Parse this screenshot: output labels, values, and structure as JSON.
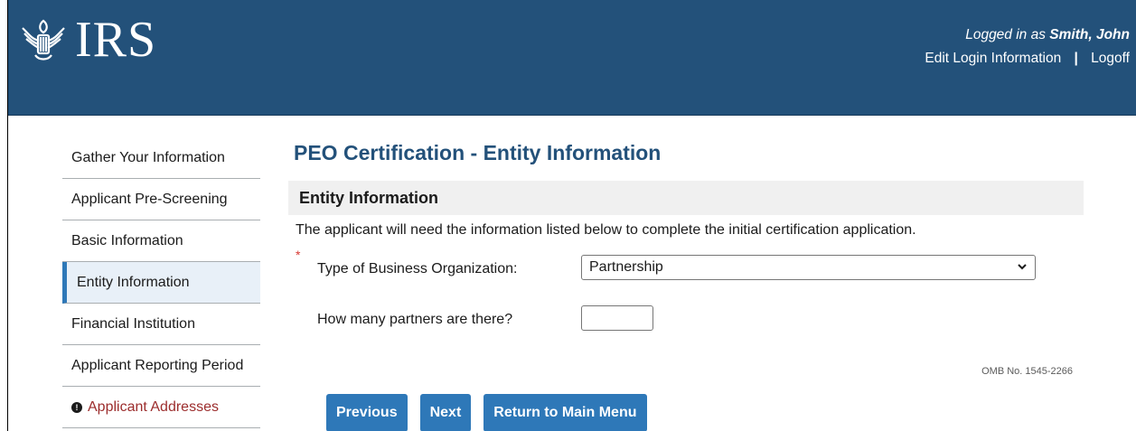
{
  "header": {
    "logo_text": "IRS",
    "logged_in_prefix": "Logged in as",
    "user_name": "Smith, John",
    "edit_login": "Edit Login Information",
    "separator": "|",
    "logoff": "Logoff"
  },
  "sidebar": {
    "items": [
      {
        "label": "Gather Your Information"
      },
      {
        "label": "Applicant Pre-Screening"
      },
      {
        "label": "Basic Information"
      },
      {
        "label": "Entity Information"
      },
      {
        "label": "Financial Institution"
      },
      {
        "label": "Applicant Reporting Period"
      },
      {
        "label": "Applicant Addresses"
      }
    ]
  },
  "main": {
    "page_title": "PEO Certification - Entity Information",
    "section_title": "Entity Information",
    "description": "The applicant will need the information listed below to complete the initial certification application.",
    "required_marker": "*",
    "business_type_label": "Type of Business Organization:",
    "business_type_value": "Partnership",
    "partners_label": "How many partners are there?",
    "partners_value": "",
    "omb": "OMB No. 1545-2266"
  },
  "buttons": {
    "previous": "Previous",
    "next": "Next",
    "return": "Return to Main Menu"
  },
  "colors": {
    "header_bg": "#23517a",
    "primary_button": "#2e78b8",
    "active_accent": "#2e78b8",
    "required": "#d83933",
    "alert_text": "#9c2d2d"
  }
}
